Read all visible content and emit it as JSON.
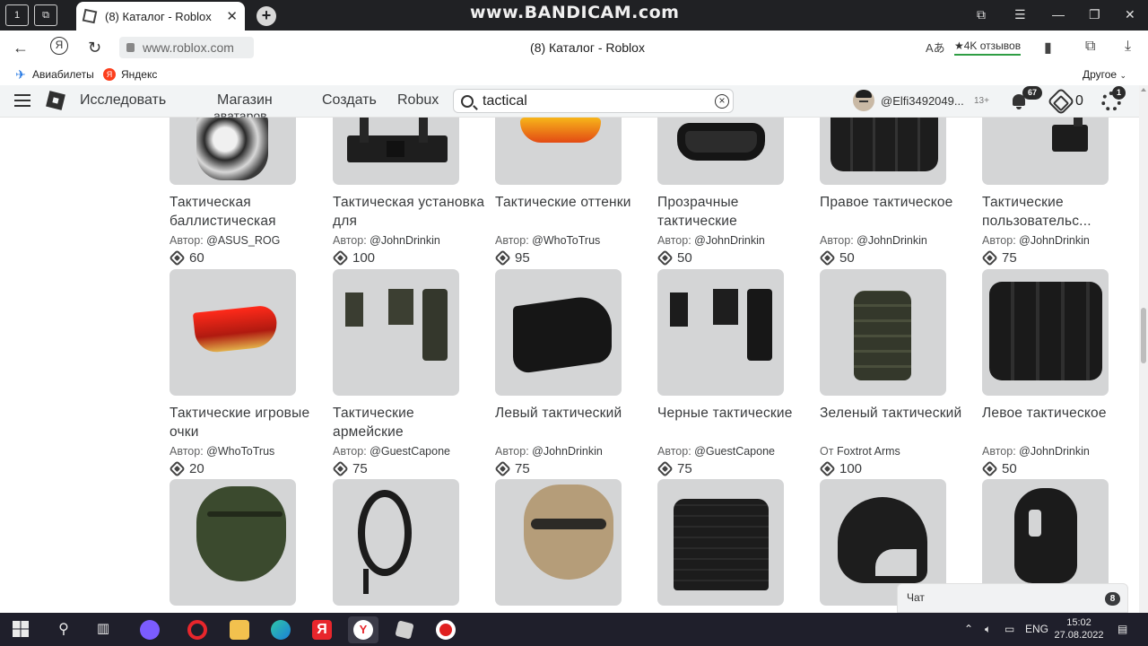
{
  "browser": {
    "tab_title": "(8) Каталог - Roblox",
    "watermark": "www.BANDICAM.com",
    "url": "www.roblox.com",
    "page_title": "(8) Каталог - Roblox",
    "reviews": "★4K отзывов",
    "bookmarks": [
      {
        "label": "Авиабилеты",
        "icon": "plane-icon",
        "color": "#2a7be4"
      },
      {
        "label": "Яндекс",
        "icon": "yandex-icon",
        "color": "#fc3f1d"
      }
    ],
    "other_bookmarks": "Другое"
  },
  "nav": {
    "explore": "Исследовать",
    "shop_line1": "Магазин",
    "shop_line2": "аватаров",
    "create": "Создать",
    "robux": "Robux",
    "search_value": "tactical",
    "username": "@Elfi3492049...",
    "age": "13+",
    "notifications": "67",
    "robux_balance": "0",
    "settings_badge": "1"
  },
  "items": [
    {
      "name": "Тактическая баллистическая",
      "creator_prefix": "Автор:",
      "creator": "@ASUS_ROG",
      "price": "60",
      "icon": "ballistic-mask-icon"
    },
    {
      "name": "Тактическая установка для",
      "creator_prefix": "Автор:",
      "creator": "@JohnDrinkin",
      "price": "100",
      "icon": "tactical-rig-icon"
    },
    {
      "name": "Тактические оттенки",
      "creator_prefix": "Автор:",
      "creator": "@WhoToTrus",
      "price": "95",
      "icon": "tinted-glasses-icon"
    },
    {
      "name": "Прозрачные тактические",
      "creator_prefix": "Автор:",
      "creator": "@JohnDrinkin",
      "price": "50",
      "icon": "goggles-icon"
    },
    {
      "name": "Правое тактическое",
      "creator_prefix": "Автор:",
      "creator": "@JohnDrinkin",
      "price": "50",
      "icon": "backpack-icon"
    },
    {
      "name": "Тактические пользовательс...",
      "creator_prefix": "Автор:",
      "creator": "@JohnDrinkin",
      "price": "75",
      "icon": "pouch-icon"
    },
    {
      "name": "Тактические игровые очки",
      "creator_prefix": "Автор:",
      "creator": "@WhoToTrus",
      "price": "20",
      "icon": "red-glasses-icon"
    },
    {
      "name": "Тактические армейские",
      "creator_prefix": "Автор:",
      "creator": "@GuestCapone",
      "price": "75",
      "icon": "army-pouches-icon"
    },
    {
      "name": "Левый тактический",
      "creator_prefix": "Автор:",
      "creator": "@JohnDrinkin",
      "price": "75",
      "icon": "left-holster-icon"
    },
    {
      "name": "Черные тактические",
      "creator_prefix": "Автор:",
      "creator": "@GuestCapone",
      "price": "75",
      "icon": "black-pouches-icon"
    },
    {
      "name": "Зеленый тактический",
      "creator_prefix": "От",
      "creator": "Foxtrot Arms",
      "price": "100",
      "icon": "green-backpack-icon"
    },
    {
      "name": "Левое тактическое",
      "creator_prefix": "Автор:",
      "creator": "@JohnDrinkin",
      "price": "50",
      "icon": "black-box-icon"
    },
    {
      "name": "",
      "creator_prefix": "",
      "creator": "",
      "price": "",
      "icon": "green-helmet-icon"
    },
    {
      "name": "",
      "creator_prefix": "",
      "creator": "",
      "price": "",
      "icon": "rope-hook-icon"
    },
    {
      "name": "",
      "creator_prefix": "",
      "creator": "",
      "price": "",
      "icon": "tan-helmet-icon"
    },
    {
      "name": "",
      "creator_prefix": "",
      "creator": "",
      "price": "",
      "icon": "plate-carrier-icon"
    },
    {
      "name": "",
      "creator_prefix": "",
      "creator": "",
      "price": "",
      "icon": "black-helmet-icon"
    },
    {
      "name": "",
      "creator_prefix": "",
      "creator": "",
      "price": "",
      "icon": "balaclava-icon"
    }
  ],
  "chat": {
    "label": "Чат",
    "count": "8"
  },
  "taskbar": {
    "language": "ENG",
    "time": "15:02",
    "date": "27.08.2022"
  }
}
